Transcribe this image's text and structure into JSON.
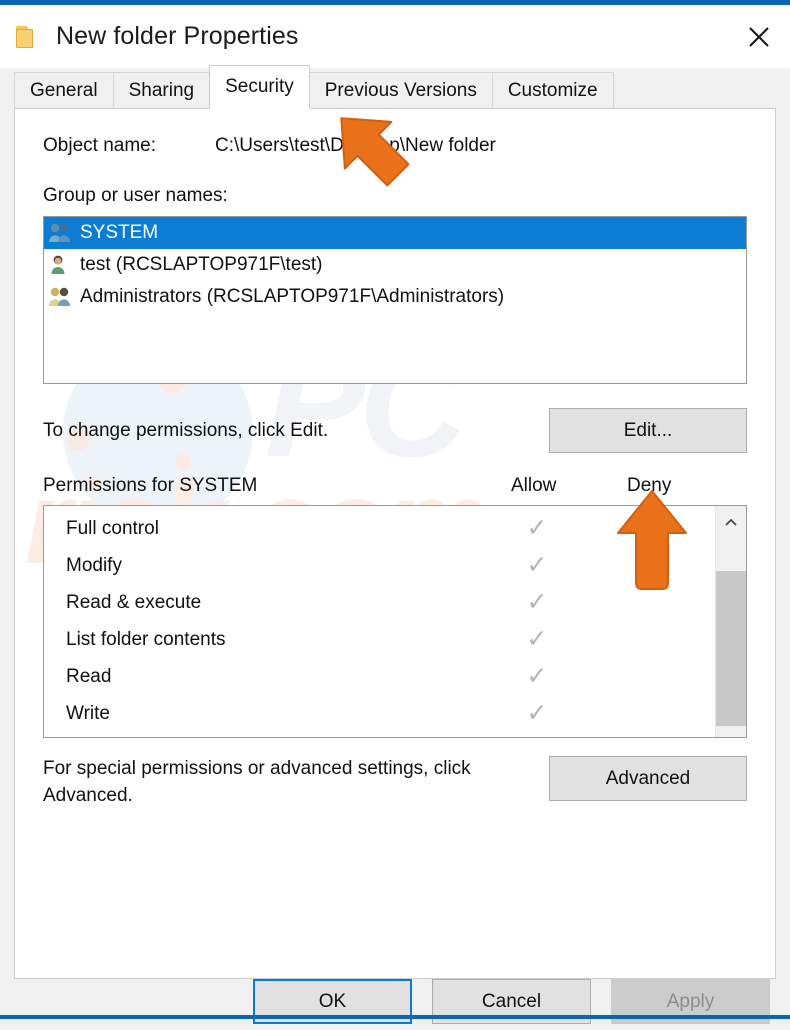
{
  "window": {
    "title": "New folder Properties",
    "folder_icon": "folder-icon",
    "close_icon": "close-icon",
    "accent_color": "#0a66b5"
  },
  "tabs": [
    {
      "label": "General",
      "active": false
    },
    {
      "label": "Sharing",
      "active": false
    },
    {
      "label": "Security",
      "active": true
    },
    {
      "label": "Previous Versions",
      "active": false
    },
    {
      "label": "Customize",
      "active": false
    }
  ],
  "security": {
    "object_name_label": "Object name:",
    "object_name_value": "C:\\Users\\test\\Desktop\\New folder",
    "group_list_label": "Group or user names:",
    "users": [
      {
        "name": "SYSTEM",
        "icon": "group-users-icon",
        "selected": true
      },
      {
        "name": "test (RCSLAPTOP971F\\test)",
        "icon": "single-user-icon",
        "selected": false
      },
      {
        "name": "Administrators (RCSLAPTOP971F\\Administrators)",
        "icon": "group-users-icon",
        "selected": false
      }
    ],
    "edit_hint": "To change permissions, click Edit.",
    "edit_button": "Edit...",
    "permissions_title": "Permissions for SYSTEM",
    "column_allow": "Allow",
    "column_deny": "Deny",
    "permissions": [
      {
        "name": "Full control",
        "allow": true,
        "deny": false
      },
      {
        "name": "Modify",
        "allow": true,
        "deny": false
      },
      {
        "name": "Read & execute",
        "allow": true,
        "deny": false
      },
      {
        "name": "List folder contents",
        "allow": true,
        "deny": false
      },
      {
        "name": "Read",
        "allow": true,
        "deny": false
      },
      {
        "name": "Write",
        "allow": true,
        "deny": false
      }
    ],
    "check_glyph": "✓",
    "scroll_up_icon": "chevron-up-icon",
    "scroll_down_icon": "chevron-down-icon",
    "advanced_hint": "For special permissions or advanced settings, click Advanced.",
    "advanced_button": "Advanced"
  },
  "footer": {
    "ok": "OK",
    "cancel": "Cancel",
    "apply": "Apply"
  },
  "annotations": [
    {
      "name": "arrow-pointing-security-tab",
      "color": "#e8711a"
    },
    {
      "name": "arrow-pointing-edit-button",
      "color": "#e8711a"
    }
  ]
}
